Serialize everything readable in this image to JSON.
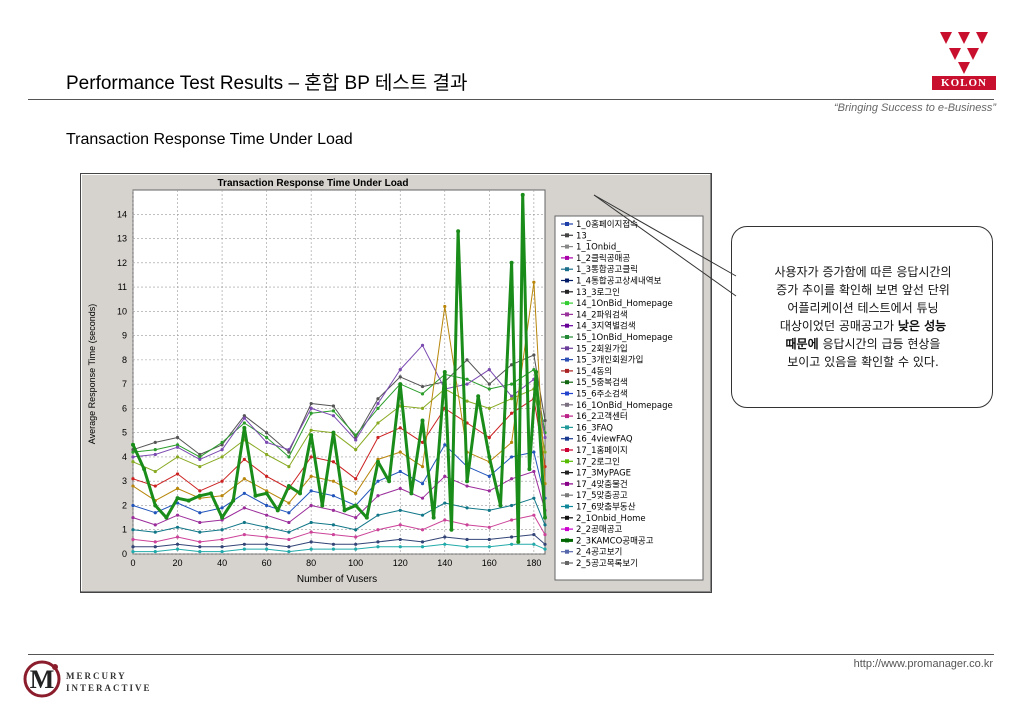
{
  "header": {
    "title": "Performance Test Results –  혼합 BP 테스트 결과",
    "tagline": "“Bringing Success to e-Business”",
    "brand": "KOLON"
  },
  "section_title": "Transaction Response Time Under Load",
  "callout": {
    "line1": "사용자가 증가함에 따른 응답시간의",
    "line2": "증가 추이를 확인해 보면 앞선 단위",
    "line3": "어플리케이션 테스트에서 튜닝",
    "line4_pre": "대상이었던 공매공고가 ",
    "line4_bold": "낮은 성능",
    "line5_bold": "때문에",
    "line5_post": " 응답시간의 급등 현상을",
    "line6": "보이고 있음을 확인할 수 있다."
  },
  "footer": {
    "url": "http://www.promanager.co.kr",
    "logo_line1": "MERCURY",
    "logo_line2": "INTERACTIVE"
  },
  "colors": {
    "kolon_red": "#c8102e",
    "highlight_series": "#1a8c1a"
  },
  "chart_data": {
    "type": "line",
    "title": "Transaction Response Time Under Load",
    "xlabel": "Number of Vusers",
    "ylabel": "Average Response Time (seconds)",
    "xlim": [
      0,
      185
    ],
    "ylim": [
      0,
      15
    ],
    "xticks": [
      0,
      20,
      40,
      60,
      80,
      100,
      120,
      140,
      160,
      180
    ],
    "yticks": [
      0,
      1,
      2,
      3,
      4,
      5,
      6,
      7,
      8,
      9,
      10,
      11,
      12,
      13,
      14
    ],
    "grid": true,
    "legend_position": "right",
    "legend": [
      "1_0홈페이지접속",
      "13_",
      "1_1Onbid_",
      "1_2클릭공매공",
      "1_3통합공고클릭",
      "1_4통합공고상세내역보",
      "13_3로그인",
      "14_1OnBid_Homepage",
      "14_2파워검색",
      "14_3지역별검색",
      "15_1OnBid_Homepage",
      "15_2회원가입",
      "15_3개인회원가입",
      "15_4동의",
      "15_5중복검색",
      "15_6주소검색",
      "16_1OnBid_Homepage",
      "16_2고객센터",
      "16_3FAQ",
      "16_4viewFAQ",
      "17_1홈페이지",
      "17_2로그인",
      "17_3MyPAGE",
      "17_4맞춤물건",
      "17_5맞춤공고",
      "17_6맞춤부동산",
      "2_1Onbid_Home",
      "2_2공매공고",
      "2_3KAMCO공매공고",
      "2_4공고보기",
      "2_5공고목록보기"
    ],
    "series": [
      {
        "name": "2_3KAMCO공매공고",
        "highlight": true,
        "x": [
          0,
          5,
          10,
          15,
          20,
          25,
          30,
          35,
          40,
          45,
          50,
          55,
          60,
          65,
          70,
          75,
          80,
          85,
          90,
          95,
          100,
          105,
          110,
          115,
          120,
          125,
          130,
          135,
          140,
          143,
          146,
          150,
          155,
          160,
          165,
          170,
          173,
          175,
          178,
          181,
          185
        ],
        "y": [
          4.5,
          3.5,
          2.0,
          1.5,
          2.3,
          2.2,
          2.4,
          2.5,
          1.5,
          2.2,
          5.2,
          2.4,
          2.5,
          1.8,
          2.8,
          2.5,
          4.9,
          2.0,
          5.0,
          1.8,
          2.0,
          1.5,
          3.8,
          3.0,
          7.0,
          2.5,
          5.5,
          1.5,
          7.5,
          1.0,
          13.3,
          3.0,
          6.5,
          4.0,
          2.0,
          12.0,
          0.5,
          14.8,
          3.5,
          7.5,
          1.5
        ]
      },
      {
        "name": "1_0홈페이지접속",
        "x": [
          0,
          10,
          20,
          30,
          40,
          50,
          60,
          70,
          80,
          90,
          100,
          110,
          120,
          130,
          140,
          150,
          160,
          170,
          180,
          185
        ],
        "y": [
          4.3,
          4.6,
          4.8,
          4.1,
          4.5,
          5.7,
          5.0,
          4.2,
          6.2,
          6.1,
          4.8,
          6.4,
          7.3,
          6.9,
          7.1,
          8.0,
          7.0,
          7.8,
          8.2,
          5.5
        ]
      },
      {
        "name": "14_1OnBid_Homepage",
        "x": [
          0,
          10,
          20,
          30,
          40,
          50,
          60,
          70,
          80,
          90,
          100,
          110,
          120,
          130,
          140,
          150,
          160,
          170,
          180,
          185
        ],
        "y": [
          4.2,
          4.3,
          4.5,
          4.0,
          4.6,
          5.4,
          4.8,
          4.0,
          5.8,
          5.9,
          4.9,
          6.0,
          7.0,
          6.6,
          7.4,
          7.2,
          6.8,
          7.0,
          7.6,
          5.0
        ]
      },
      {
        "name": "16_1OnBid_Homepage",
        "x": [
          0,
          10,
          20,
          30,
          40,
          50,
          60,
          70,
          80,
          90,
          100,
          110,
          120,
          130,
          140,
          150,
          160,
          170,
          180,
          185
        ],
        "y": [
          4.0,
          4.1,
          4.4,
          3.9,
          4.3,
          5.6,
          4.6,
          4.3,
          6.0,
          5.7,
          4.7,
          6.2,
          7.6,
          8.6,
          6.8,
          7.0,
          7.6,
          6.5,
          7.2,
          4.8
        ]
      },
      {
        "name": "15_1OnBid_Homepage",
        "x": [
          0,
          10,
          20,
          30,
          40,
          50,
          60,
          70,
          80,
          90,
          100,
          110,
          120,
          130,
          140,
          150,
          160,
          170,
          180,
          185
        ],
        "y": [
          3.8,
          3.4,
          4.0,
          3.6,
          4.0,
          4.7,
          4.1,
          3.6,
          5.1,
          5.0,
          4.3,
          5.4,
          6.1,
          6.0,
          6.8,
          6.3,
          6.0,
          6.4,
          6.8,
          4.2
        ]
      },
      {
        "name": "1_2클릭공매공",
        "x": [
          0,
          10,
          20,
          30,
          40,
          50,
          60,
          70,
          80,
          90,
          100,
          110,
          120,
          130,
          140,
          150,
          160,
          170,
          180,
          185
        ],
        "y": [
          3.1,
          2.8,
          3.3,
          2.6,
          3.0,
          3.9,
          3.2,
          2.7,
          4.0,
          3.8,
          3.1,
          4.8,
          5.2,
          4.6,
          6.0,
          5.4,
          4.8,
          5.8,
          6.4,
          3.6
        ]
      },
      {
        "name": "15_5중복검색",
        "x": [
          0,
          10,
          20,
          30,
          40,
          50,
          60,
          70,
          80,
          90,
          100,
          110,
          120,
          130,
          140,
          150,
          160,
          170,
          180,
          185
        ],
        "y": [
          2.8,
          2.2,
          2.7,
          2.3,
          2.4,
          3.1,
          2.6,
          2.1,
          3.2,
          3.0,
          2.5,
          3.9,
          4.2,
          3.6,
          10.2,
          4.2,
          3.8,
          4.6,
          11.2,
          2.9
        ]
      },
      {
        "name": "1_4통합공고상세내역보",
        "x": [
          0,
          10,
          20,
          30,
          40,
          50,
          60,
          70,
          80,
          90,
          100,
          110,
          120,
          130,
          140,
          150,
          160,
          170,
          180,
          185
        ],
        "y": [
          2.0,
          1.7,
          2.1,
          1.7,
          1.9,
          2.5,
          2.0,
          1.7,
          2.6,
          2.4,
          2.0,
          3.0,
          3.4,
          2.9,
          4.5,
          3.6,
          3.2,
          4.0,
          4.2,
          2.3
        ]
      },
      {
        "name": "14_3지역별검색",
        "x": [
          0,
          10,
          20,
          30,
          40,
          50,
          60,
          70,
          80,
          90,
          100,
          110,
          120,
          130,
          140,
          150,
          160,
          170,
          180,
          185
        ],
        "y": [
          1.5,
          1.2,
          1.6,
          1.3,
          1.4,
          1.9,
          1.6,
          1.3,
          2.0,
          1.8,
          1.5,
          2.4,
          2.7,
          2.3,
          3.2,
          2.8,
          2.6,
          3.1,
          3.4,
          1.8
        ]
      },
      {
        "name": "17_4맞춤물건",
        "x": [
          0,
          10,
          20,
          30,
          40,
          50,
          60,
          70,
          80,
          90,
          100,
          110,
          120,
          130,
          140,
          150,
          160,
          170,
          180,
          185
        ],
        "y": [
          1.0,
          0.9,
          1.1,
          0.9,
          1.0,
          1.3,
          1.1,
          0.9,
          1.3,
          1.2,
          1.0,
          1.6,
          1.8,
          1.6,
          2.1,
          1.9,
          1.8,
          2.0,
          2.3,
          1.2
        ]
      },
      {
        "name": "2_2공매공고",
        "x": [
          0,
          10,
          20,
          30,
          40,
          50,
          60,
          70,
          80,
          90,
          100,
          110,
          120,
          130,
          140,
          150,
          160,
          170,
          180,
          185
        ],
        "y": [
          0.6,
          0.5,
          0.7,
          0.5,
          0.6,
          0.8,
          0.7,
          0.6,
          0.9,
          0.8,
          0.7,
          1.0,
          1.2,
          1.0,
          1.4,
          1.2,
          1.1,
          1.4,
          1.6,
          0.8
        ]
      },
      {
        "name": "17_1홈페이지",
        "x": [
          0,
          10,
          20,
          30,
          40,
          50,
          60,
          70,
          80,
          90,
          100,
          110,
          120,
          130,
          140,
          150,
          160,
          170,
          180,
          185
        ],
        "y": [
          0.3,
          0.3,
          0.4,
          0.3,
          0.3,
          0.4,
          0.4,
          0.3,
          0.5,
          0.4,
          0.4,
          0.5,
          0.6,
          0.5,
          0.7,
          0.6,
          0.6,
          0.7,
          0.8,
          0.4
        ]
      },
      {
        "name": "2_5공고목록보기",
        "x": [
          0,
          10,
          20,
          30,
          40,
          50,
          60,
          70,
          80,
          90,
          100,
          110,
          120,
          130,
          140,
          150,
          160,
          170,
          180,
          185
        ],
        "y": [
          0.1,
          0.1,
          0.2,
          0.1,
          0.1,
          0.2,
          0.2,
          0.1,
          0.2,
          0.2,
          0.2,
          0.3,
          0.3,
          0.3,
          0.4,
          0.3,
          0.3,
          0.4,
          0.4,
          0.2
        ]
      }
    ]
  }
}
